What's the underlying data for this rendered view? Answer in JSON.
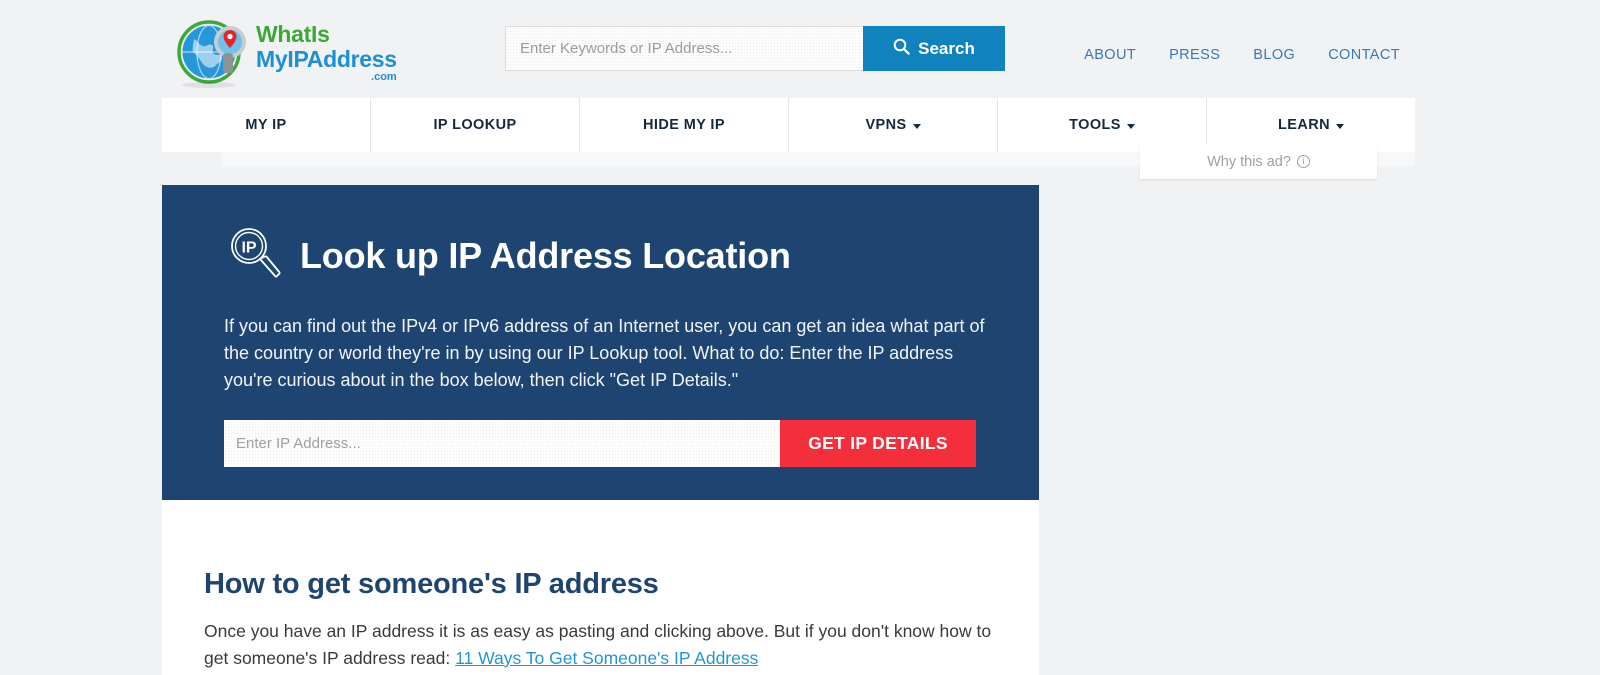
{
  "brand": {
    "name_line1": "WhatIs",
    "name_line2": "MyIPAddress",
    "tld": ".com",
    "green": "#3aa935",
    "blue": "#1e8fd5"
  },
  "search": {
    "placeholder": "Enter Keywords or IP Address...",
    "value": "",
    "button_label": "Search",
    "icon": "search-icon",
    "button_color": "#1082bd"
  },
  "top_nav": {
    "items": [
      {
        "label": "ABOUT"
      },
      {
        "label": "PRESS"
      },
      {
        "label": "BLOG"
      },
      {
        "label": "CONTACT"
      }
    ],
    "link_color": "#3c76b4"
  },
  "main_nav": {
    "items": [
      {
        "label": "MY IP",
        "has_dropdown": false
      },
      {
        "label": "IP LOOKUP",
        "has_dropdown": false
      },
      {
        "label": "HIDE MY IP",
        "has_dropdown": false
      },
      {
        "label": "VPNS",
        "has_dropdown": true
      },
      {
        "label": "TOOLS",
        "has_dropdown": true
      },
      {
        "label": "LEARN",
        "has_dropdown": true
      }
    ]
  },
  "ad": {
    "label": "Why this ad?",
    "icon": "info-circle-icon"
  },
  "hero": {
    "icon": "ip-magnifier-icon",
    "icon_text": "IP",
    "title": "Look up IP Address Location",
    "body": "If you can find out the IPv4 or IPv6 address of an Internet user, you can get an idea what part of the country or world they're in by using our IP Lookup tool. What to do: Enter the IP address you're curious about in the box below, then click \"Get IP Details.\"",
    "input_placeholder": "Enter IP Address...",
    "input_value": "",
    "button_label": "GET IP DETAILS",
    "background_color": "#1e4571",
    "button_color": "#f42f3c"
  },
  "article": {
    "title": "How to get someone's IP address",
    "body_before_link": "Once you have an IP address it is as easy as pasting and clicking above. But if you don't know how to get someone's IP address read: ",
    "link_label": "11 Ways To Get Someone's IP Address",
    "link_color": "#2196d6"
  }
}
